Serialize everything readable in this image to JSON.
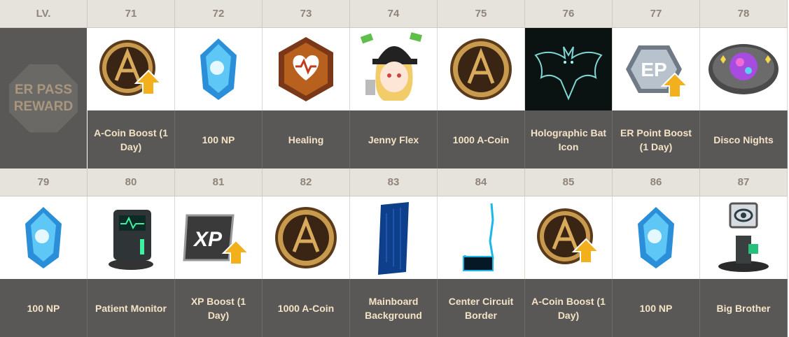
{
  "header": {
    "lv_label": "LV."
  },
  "side_label": {
    "line1": "ER PASS",
    "line2": "REWARD"
  },
  "rows": [
    {
      "levels": [
        "71",
        "72",
        "73",
        "74",
        "75",
        "76",
        "77",
        "78"
      ],
      "rewards": [
        {
          "name": "A-Coin Boost (1 Day)",
          "icon": "acoin-boost-icon"
        },
        {
          "name": "100 NP",
          "icon": "np-crystal-icon"
        },
        {
          "name": "Healing",
          "icon": "healing-heart-icon"
        },
        {
          "name": "Jenny Flex",
          "icon": "jenny-flex-emote-icon"
        },
        {
          "name": "1000 A-Coin",
          "icon": "acoin-icon"
        },
        {
          "name": "Holographic Bat Icon",
          "icon": "holographic-bat-icon"
        },
        {
          "name": "ER Point Boost (1 Day)",
          "icon": "ep-boost-icon"
        },
        {
          "name": "Disco Nights",
          "icon": "disco-ball-icon"
        }
      ]
    },
    {
      "levels": [
        "79",
        "80",
        "81",
        "82",
        "83",
        "84",
        "85",
        "86",
        "87"
      ],
      "rewards": [
        {
          "name": "100 NP",
          "icon": "np-crystal-icon"
        },
        {
          "name": "Patient Monitor",
          "icon": "patient-monitor-icon"
        },
        {
          "name": "XP Boost (1 Day)",
          "icon": "xp-boost-icon"
        },
        {
          "name": "1000 A-Coin",
          "icon": "acoin-icon"
        },
        {
          "name": "Mainboard Background",
          "icon": "mainboard-background-icon"
        },
        {
          "name": "Center Circuit Border",
          "icon": "circuit-border-icon"
        },
        {
          "name": "A-Coin Boost (1 Day)",
          "icon": "acoin-boost-icon"
        },
        {
          "name": "100 NP",
          "icon": "np-crystal-icon"
        },
        {
          "name": "Big Brother",
          "icon": "big-brother-camera-icon"
        }
      ]
    }
  ],
  "colors": {
    "header_bg": "#e6e2dc",
    "header_text": "#8f8479",
    "name_bg": "#5a5856",
    "name_text": "#f3e3c6"
  }
}
